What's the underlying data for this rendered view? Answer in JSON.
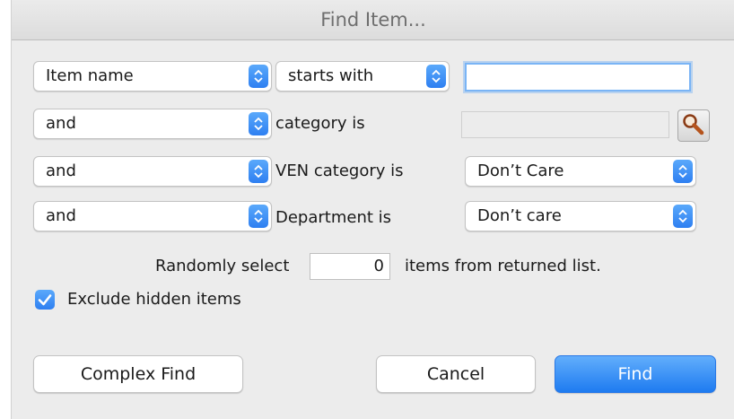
{
  "dialog": {
    "title": "Find Item..."
  },
  "rows": {
    "row1": {
      "field": "Item name",
      "operator": "starts with",
      "value": ""
    },
    "row2": {
      "conjunction": "and",
      "label": "category is",
      "value": ""
    },
    "row3": {
      "conjunction": "and",
      "label": "VEN category is",
      "value": "Don’t Care"
    },
    "row4": {
      "conjunction": "and",
      "label": "Department is",
      "value": "Don’t care"
    }
  },
  "random_select": {
    "prefix": "Randomly select",
    "count": "0",
    "suffix": "items from returned list."
  },
  "exclude_hidden": {
    "label": "Exclude hidden items",
    "checked": true
  },
  "buttons": {
    "complex_find": "Complex Find",
    "cancel": "Cancel",
    "find": "Find"
  },
  "icons": {
    "lookup": "magnifier-icon",
    "checkbox": "checkmark-icon",
    "stepper": "up-down-stepper-icon"
  },
  "colors": {
    "accent": "#2e7ff1",
    "window_bg": "#ececec",
    "title_text": "#6e6e6e"
  }
}
